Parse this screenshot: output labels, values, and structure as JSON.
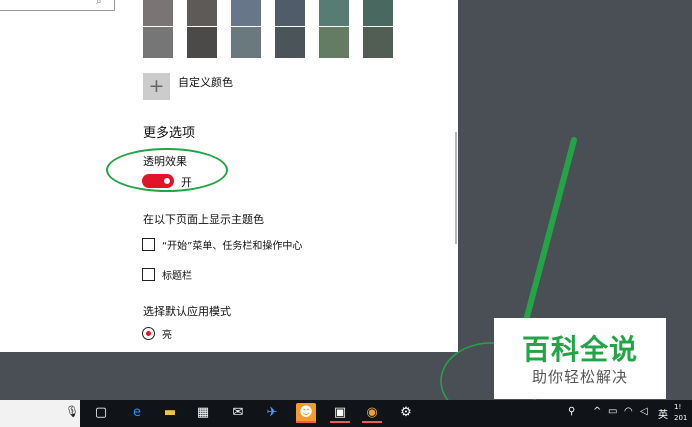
{
  "colors": {
    "accent": "#e0152a",
    "annotation_green": "#23a447",
    "swatches_row1": [
      "#7a7574",
      "#5d5a58",
      "#68768a",
      "#515c6b",
      "#567c73",
      "#486860",
      "#498205",
      "#107c10"
    ],
    "swatches_row2": [
      "#767676",
      "#4c4a48",
      "#69797e",
      "#4a5459",
      "#647c64",
      "#525e54",
      "#847545",
      "#7e735f"
    ]
  },
  "custom_color": {
    "icon": "plus-icon",
    "label": "自定义颜色"
  },
  "more_options": {
    "heading": "更多选项",
    "transparency": {
      "label": "透明效果",
      "state_label": "开",
      "on": true
    }
  },
  "accent_surfaces": {
    "heading": "在以下页面上显示主题色",
    "options": [
      {
        "label": "“开始”菜单、任务栏和操作中心",
        "checked": false
      },
      {
        "label": "标题栏",
        "checked": false
      }
    ]
  },
  "app_mode": {
    "heading": "选择默认应用模式",
    "selected_option": "亮"
  },
  "watermark": {
    "title": "百科全说",
    "subtitle": "助你轻松解决"
  },
  "taskbar": {
    "icons": [
      {
        "name": "task-view-icon",
        "glyph": "▢",
        "bg": "transparent",
        "color": "#ffffff"
      },
      {
        "name": "edge-icon",
        "glyph": "e",
        "bg": "transparent",
        "color": "#1e90ff"
      },
      {
        "name": "file-explorer-icon",
        "glyph": "▬",
        "bg": "transparent",
        "color": "#f3c24a"
      },
      {
        "name": "store-icon",
        "glyph": "▦",
        "bg": "transparent",
        "color": "#ffffff"
      },
      {
        "name": "mail-icon",
        "glyph": "✉",
        "bg": "transparent",
        "color": "#ffffff"
      },
      {
        "name": "bird-app-icon",
        "glyph": "✈",
        "bg": "transparent",
        "color": "#4aa3ff"
      },
      {
        "name": "game-app-icon",
        "glyph": "☻",
        "bg": "#f39c2a",
        "color": "#ffffff"
      },
      {
        "name": "bilibili-icon",
        "glyph": "▣",
        "bg": "transparent",
        "color": "#ffffff"
      },
      {
        "name": "chrome-icon",
        "glyph": "◉",
        "bg": "transparent",
        "color": "#e8a33d"
      },
      {
        "name": "settings-icon",
        "glyph": "⚙",
        "bg": "transparent",
        "color": "#ffffff"
      }
    ],
    "tray": {
      "people_icon": "people-icon",
      "chevron_icon": "chevron-up-icon",
      "battery_icon": "battery-icon",
      "wifi_icon": "wifi-icon",
      "volume_icon": "volume-icon",
      "ime_label": "英",
      "clock_line1": "1!",
      "clock_line2": "201"
    }
  }
}
